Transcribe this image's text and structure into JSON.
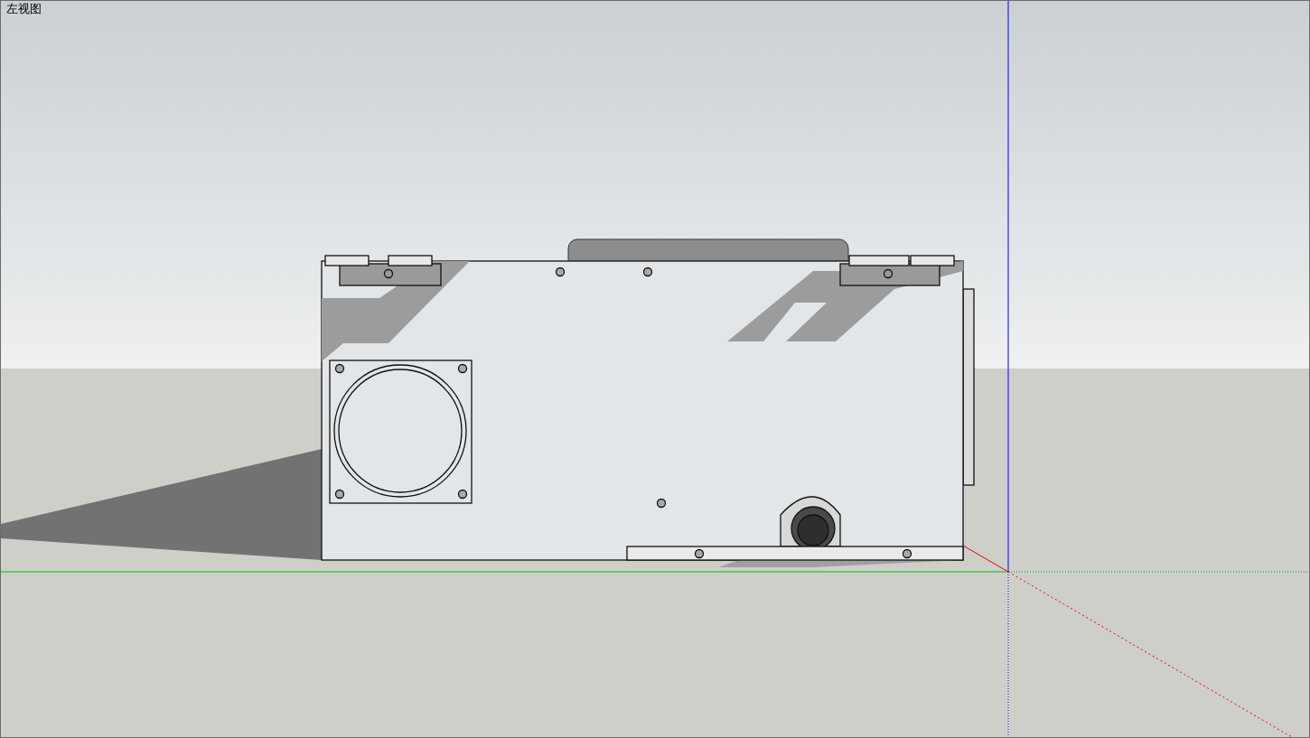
{
  "view": {
    "title": "左视图"
  }
}
